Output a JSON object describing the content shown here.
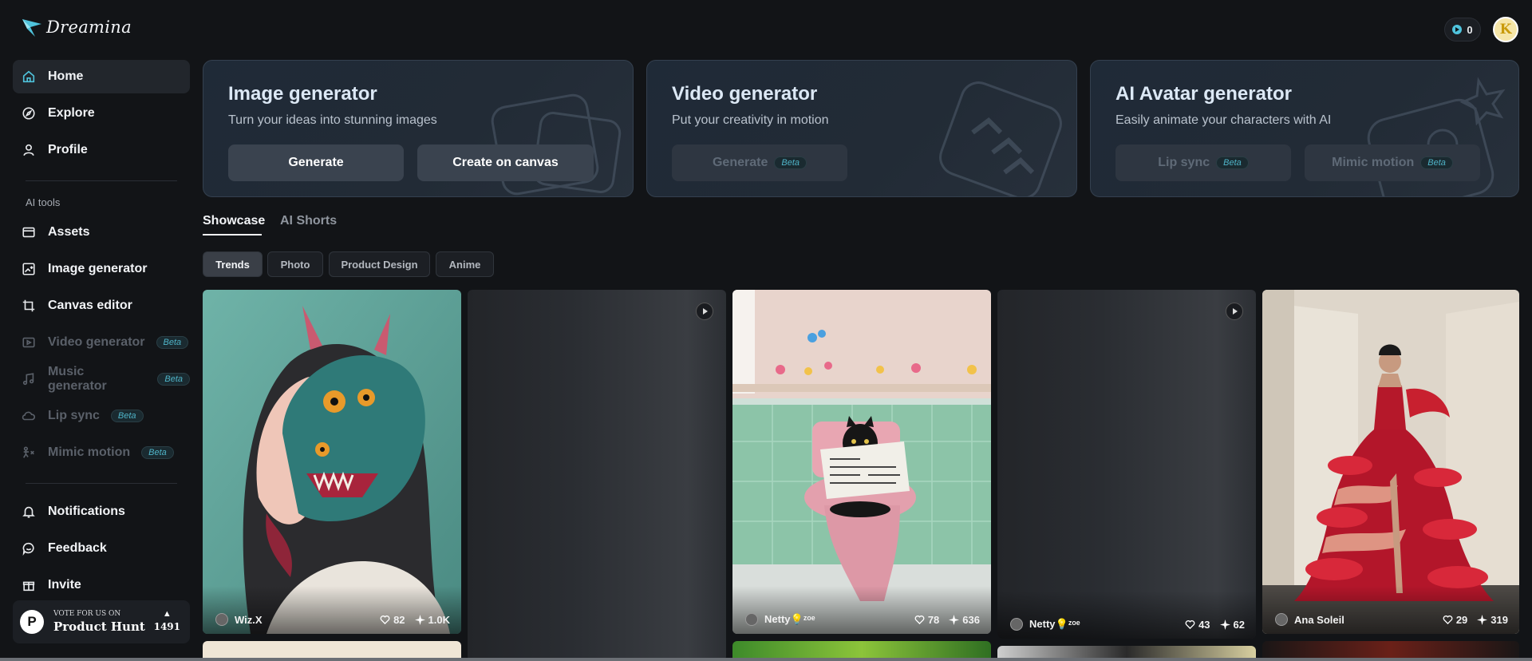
{
  "brand": {
    "name": "Dreamina"
  },
  "topbar": {
    "credits": "0",
    "avatar_letter": "K"
  },
  "sidebar": {
    "main": [
      {
        "label": "Home",
        "icon": "home-icon"
      },
      {
        "label": "Explore",
        "icon": "compass-icon"
      },
      {
        "label": "Profile",
        "icon": "user-icon"
      }
    ],
    "tools_label": "AI tools",
    "tools": [
      {
        "label": "Assets",
        "icon": "folder-icon"
      },
      {
        "label": "Image generator",
        "icon": "image-plus-icon"
      },
      {
        "label": "Canvas editor",
        "icon": "crop-icon"
      },
      {
        "label": "Video generator",
        "badge": "Beta",
        "icon": "video-icon"
      },
      {
        "label": "Music generator",
        "badge": "Beta",
        "icon": "music-icon"
      },
      {
        "label": "Lip sync",
        "badge": "Beta",
        "icon": "cloud-icon"
      },
      {
        "label": "Mimic motion",
        "badge": "Beta",
        "icon": "motion-icon"
      }
    ],
    "bottom": [
      {
        "label": "Notifications",
        "icon": "bell-icon"
      },
      {
        "label": "Feedback",
        "icon": "chat-icon"
      },
      {
        "label": "Invite",
        "icon": "gift-icon"
      }
    ],
    "product_hunt": {
      "logo": "P",
      "small": "VOTE FOR US ON",
      "big": "Product Hunt",
      "count": "1491"
    }
  },
  "generators": [
    {
      "title": "Image generator",
      "subtitle": "Turn your ideas into stunning images",
      "buttons": [
        {
          "label": "Generate"
        },
        {
          "label": "Create on canvas"
        }
      ]
    },
    {
      "title": "Video generator",
      "subtitle": "Put your creativity in motion",
      "buttons": [
        {
          "label": "Generate",
          "badge": "Beta"
        }
      ]
    },
    {
      "title": "AI Avatar generator",
      "subtitle": "Easily animate your characters with AI",
      "buttons": [
        {
          "label": "Lip sync",
          "badge": "Beta"
        },
        {
          "label": "Mimic motion",
          "badge": "Beta"
        }
      ]
    }
  ],
  "tabs": [
    "Showcase",
    "AI Shorts"
  ],
  "filters": [
    "Trends",
    "Photo",
    "Product Design",
    "Anime"
  ],
  "gallery": [
    {
      "author": "Wiz.X",
      "likes": "82",
      "remixes": "1.0K"
    },
    {
      "author": "",
      "likes": "",
      "remixes": ""
    },
    {
      "author": "Netty💡ᶻᵒᵉ",
      "likes": "78",
      "remixes": "636"
    },
    {
      "author": "Netty💡ᶻᵒᵉ",
      "likes": "43",
      "remixes": "62"
    },
    {
      "author": "Ana Soleil",
      "likes": "29",
      "remixes": "319"
    }
  ],
  "colors": {
    "background": "#121417",
    "accent": "#4fb3c7",
    "card": "#222b36"
  }
}
